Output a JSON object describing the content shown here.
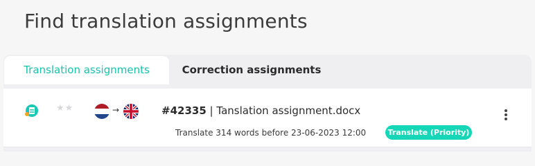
{
  "page": {
    "title": "Find translation assignments"
  },
  "tabs": [
    {
      "label": "Translation assignments",
      "active": true
    },
    {
      "label": "Correction assignments",
      "active": false
    }
  ],
  "assignment": {
    "icon": "document-chat-icon",
    "rating": "★★",
    "source_language_icon": "netherlands-flag-icon",
    "target_language_icon": "united-kingdom-flag-icon",
    "arrow": "→",
    "id": "#42335",
    "separator": "|",
    "name": "Tanslation assignment.docx",
    "deadline_text": "Translate 314 words before 23-06-2023 12:00",
    "badge": "Translate (Priority)",
    "menu_icon": "vertical-dots-icon"
  },
  "colors": {
    "accent": "#18c2ad",
    "badge": "#16d6b8",
    "background": "#f6f6f7"
  }
}
